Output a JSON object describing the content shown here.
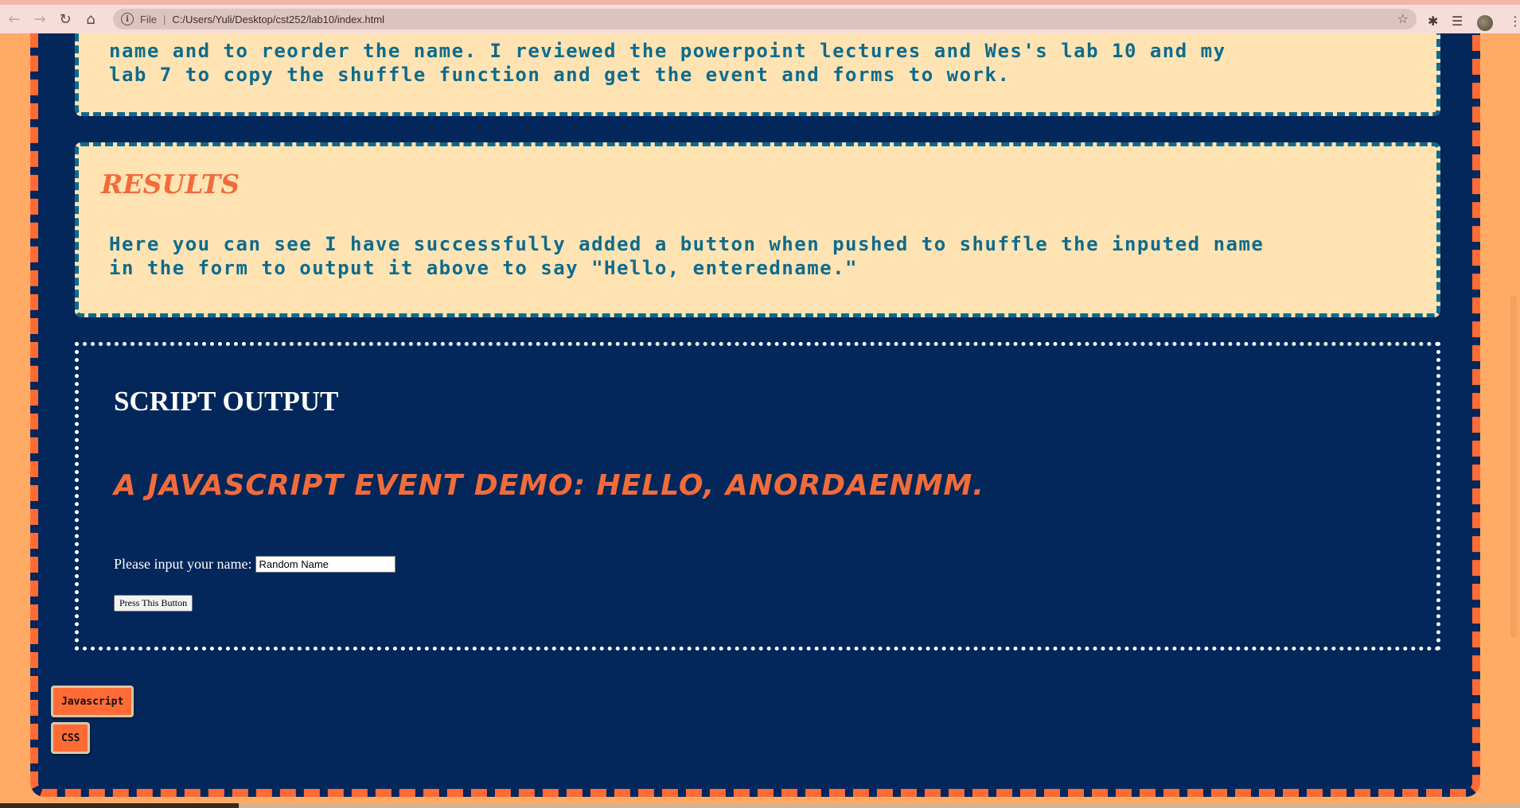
{
  "browser": {
    "file_label": "File",
    "url": "C:/Users/Yuli/Desktop/cst252/lab10/index.html",
    "icons": [
      "back-icon",
      "forward-icon",
      "reload-icon",
      "home-icon",
      "info-icon",
      "star-icon",
      "extensions-icon",
      "reading-list-icon",
      "avatar",
      "menu-icon"
    ]
  },
  "colors": {
    "page_bg": "#ffab66",
    "panel_bg": "#03275a",
    "panel_border": "#ff6b35",
    "card_bg": "#ffe3b3",
    "card_text": "#0e6b8c",
    "accent": "#f26b3a"
  },
  "card1": {
    "line1": "name and to reorder the name. I reviewed the powerpoint lectures and Wes's lab 10 and my",
    "line2": "lab 7 to copy the shuffle function and get the event and forms to work."
  },
  "results": {
    "heading": "RESULTS",
    "line1": "Here you can see I have successfully added a button when pushed to shuffle the inputed name",
    "line2": "in the form to output it above to say \"Hello, enteredname.\""
  },
  "output": {
    "title": "SCRIPT OUTPUT",
    "demo_text": "A Javascript Event Demo: Hello, anordaenmm.",
    "input_label": "Please input your name:",
    "input_value": "Random Name",
    "button_label": "Press This Button"
  },
  "tags": {
    "javascript": "Javascript",
    "css": "CSS"
  }
}
